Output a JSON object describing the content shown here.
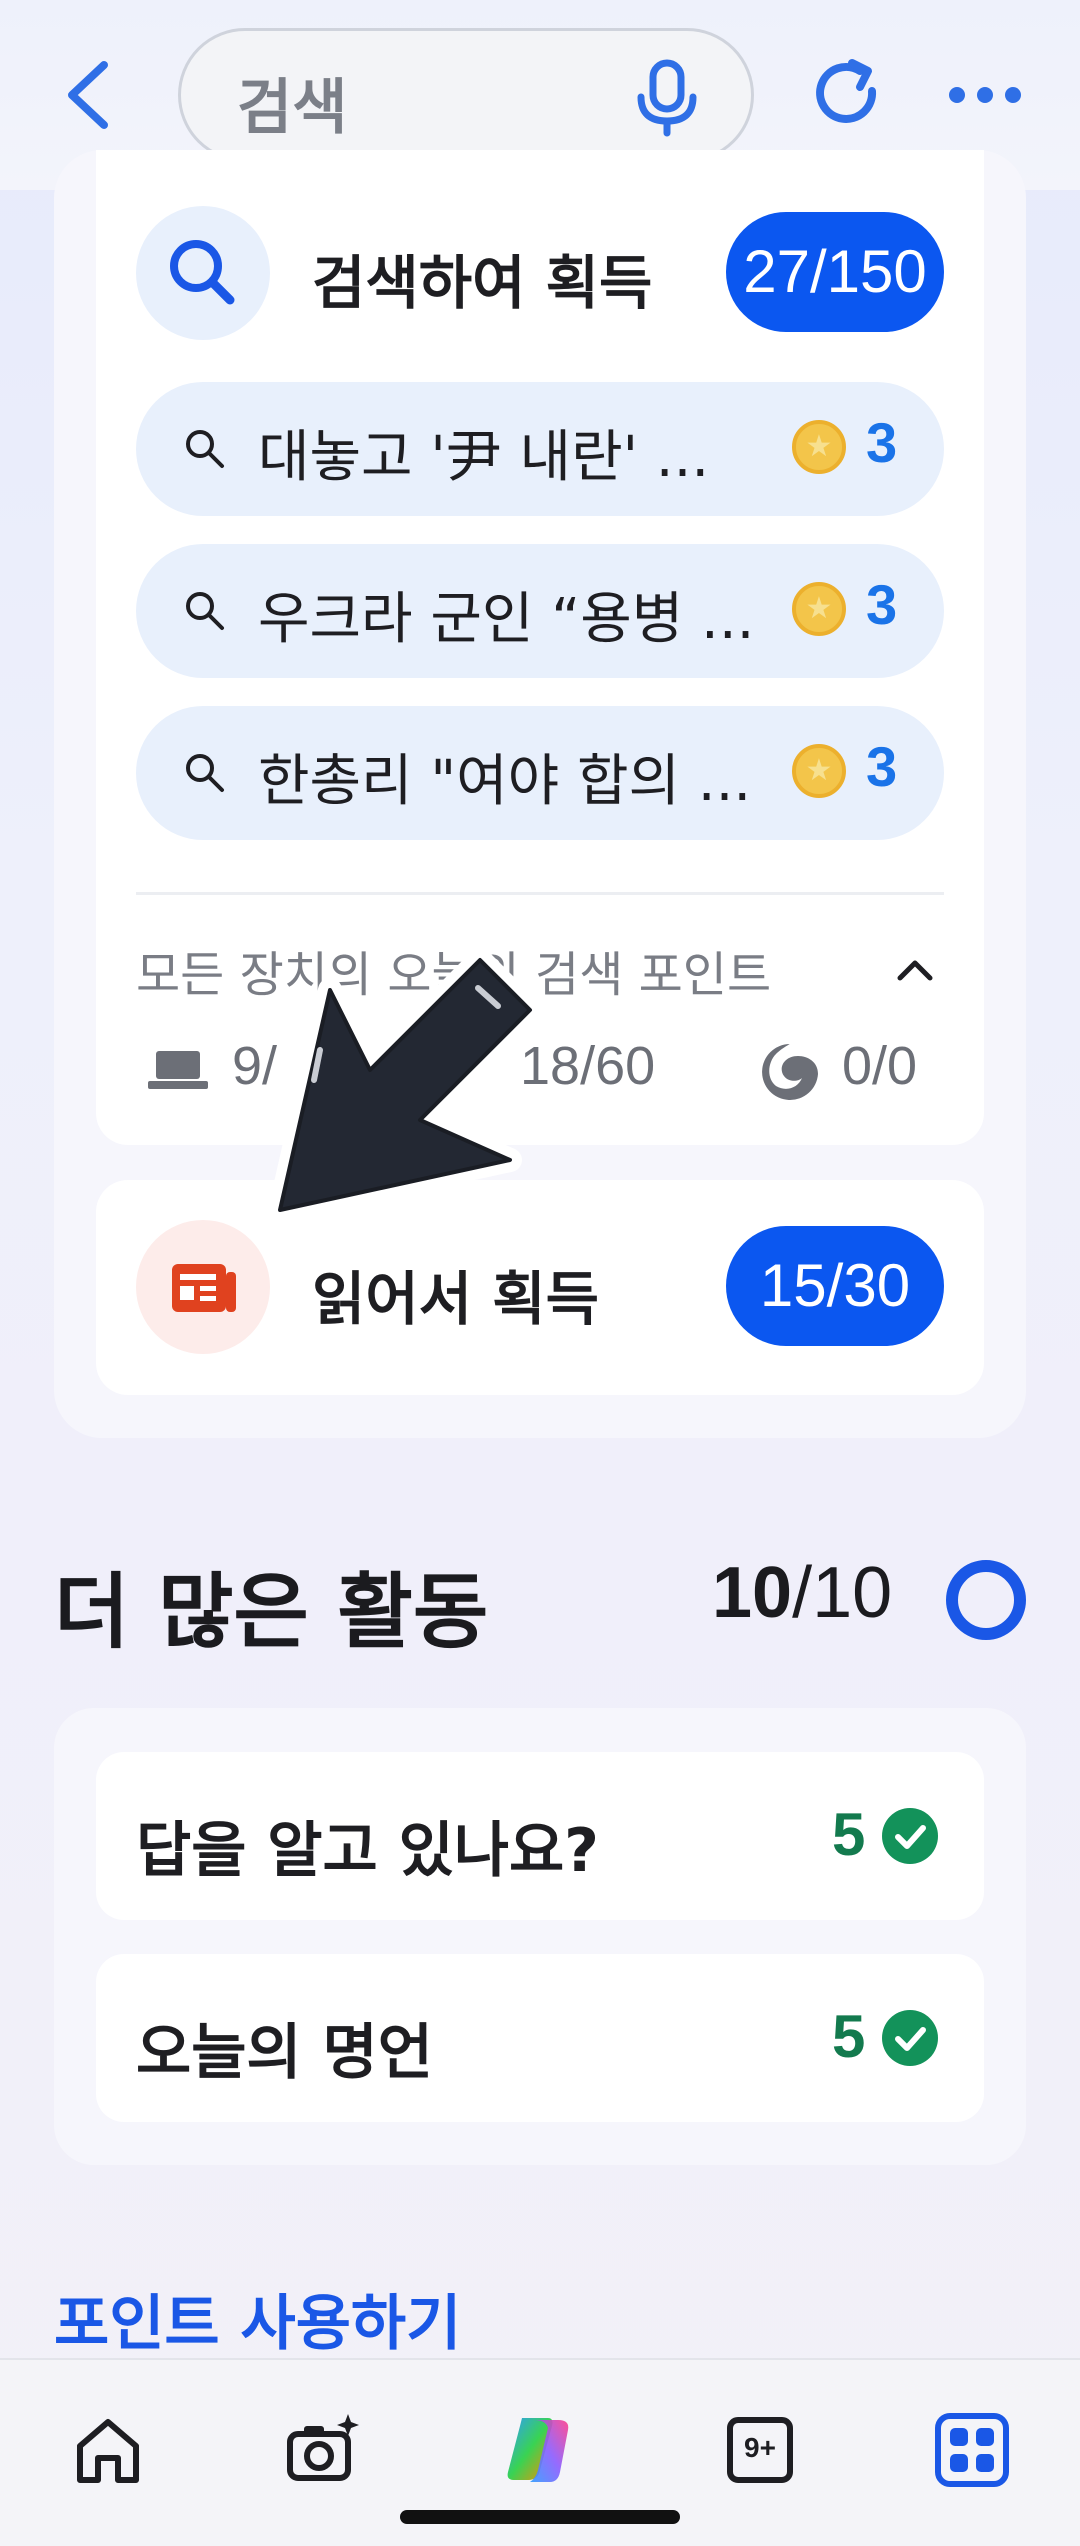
{
  "search_bar": {
    "placeholder": "검색"
  },
  "search_earn": {
    "title": "검색하여 획득",
    "progress": "27/150",
    "items": [
      {
        "query": "대놓고 '尹 내란' ...",
        "points": "3"
      },
      {
        "query": "우크라 군인 “용병 ...",
        "points": "3"
      },
      {
        "query": "한총리 \"여야 합의 ...",
        "points": "3"
      }
    ],
    "devices_title": "모든 장치의 오늘의 검색 포인트",
    "devices": [
      {
        "icon": "laptop-icon",
        "value": "9/"
      },
      {
        "icon": "mobile-icon",
        "value": "18/60"
      },
      {
        "icon": "edge-icon",
        "value": "0/0"
      }
    ]
  },
  "read_earn": {
    "title": "읽어서 획득",
    "progress": "15/30"
  },
  "more_activities": {
    "title": "더 많은 활동",
    "done": "10",
    "total": "/10",
    "items": [
      {
        "label": "답을 알고 있나요?",
        "points": "5"
      },
      {
        "label": "오늘의 명언",
        "points": "5"
      }
    ]
  },
  "use_points": "포인트 사용하기",
  "bottom_nav": [
    {
      "icon": "home-icon"
    },
    {
      "icon": "camera-sparkle-icon"
    },
    {
      "icon": "copilot-icon"
    },
    {
      "icon": "tabs-count-icon",
      "label": "9+"
    },
    {
      "icon": "apps-grid-icon"
    }
  ],
  "colors": {
    "accent": "#0b57f0",
    "success": "#137a4e",
    "link": "#1a57e6"
  }
}
